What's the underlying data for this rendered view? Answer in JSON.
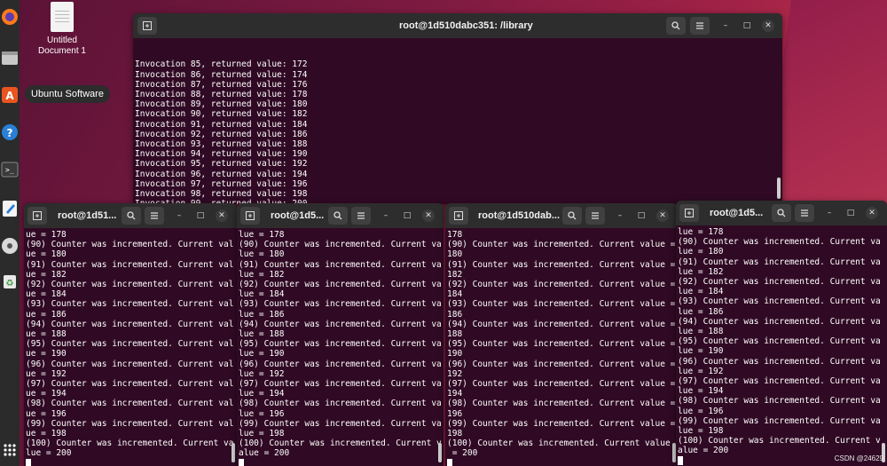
{
  "desktop": {
    "icon_label": "Untitled\nDocument 1",
    "tooltip": "Ubuntu Software",
    "watermark": "CSDN @24629"
  },
  "dock": [
    "firefox-icon",
    "files-icon",
    "software-icon",
    "help-icon",
    "terminal-icon",
    "text-editor-icon",
    "disc-icon",
    "trash-icon",
    "apps-grid-icon"
  ],
  "main_terminal": {
    "title": "root@1d510dabc351: /library",
    "lines": [
      "Invocation 85, returned value: 172",
      "Invocation 86, returned value: 174",
      "Invocation 87, returned value: 176",
      "Invocation 88, returned value: 178",
      "Invocation 89, returned value: 180",
      "Invocation 90, returned value: 182",
      "Invocation 91, returned value: 184",
      "Invocation 92, returned value: 186",
      "Invocation 93, returned value: 188",
      "Invocation 94, returned value: 190",
      "Invocation 95, returned value: 192",
      "Invocation 96, returned value: 194",
      "Invocation 97, returned value: 196",
      "Invocation 98, returned value: 198",
      "Invocation 99, returned value: 200"
    ],
    "prompt": "$ "
  },
  "terminals": [
    {
      "title": "root@1d51...",
      "lines": [
        "ue = 178",
        "(90) Counter was incremented. Current val",
        "ue = 180",
        "(91) Counter was incremented. Current val",
        "ue = 182",
        "(92) Counter was incremented. Current val",
        "ue = 184",
        "(93) Counter was incremented. Current val",
        "ue = 186",
        "(94) Counter was incremented. Current val",
        "ue = 188",
        "(95) Counter was incremented. Current val",
        "ue = 190",
        "(96) Counter was incremented. Current val",
        "ue = 192",
        "(97) Counter was incremented. Current val",
        "ue = 194",
        "(98) Counter was incremented. Current val",
        "ue = 196",
        "(99) Counter was incremented. Current val",
        "ue = 198",
        "(100) Counter was incremented. Current va",
        "lue = 200"
      ]
    },
    {
      "title": "root@1d5...",
      "lines": [
        "lue = 178",
        "(90) Counter was incremented. Current va",
        "lue = 180",
        "(91) Counter was incremented. Current va",
        "lue = 182",
        "(92) Counter was incremented. Current va",
        "lue = 184",
        "(93) Counter was incremented. Current va",
        "lue = 186",
        "(94) Counter was incremented. Current va",
        "lue = 188",
        "(95) Counter was incremented. Current va",
        "lue = 190",
        "(96) Counter was incremented. Current va",
        "lue = 192",
        "(97) Counter was incremented. Current va",
        "lue = 194",
        "(98) Counter was incremented. Current va",
        "lue = 196",
        "(99) Counter was incremented. Current va",
        "lue = 198",
        "(100) Counter was incremented. Current v",
        "alue = 200"
      ]
    },
    {
      "title": "root@1d510dab...",
      "lines": [
        "178",
        "(90) Counter was incremented. Current value =",
        "180",
        "(91) Counter was incremented. Current value =",
        "182",
        "(92) Counter was incremented. Current value =",
        "184",
        "(93) Counter was incremented. Current value =",
        "186",
        "(94) Counter was incremented. Current value =",
        "188",
        "(95) Counter was incremented. Current value =",
        "190",
        "(96) Counter was incremented. Current value =",
        "192",
        "(97) Counter was incremented. Current value =",
        "194",
        "(98) Counter was incremented. Current value =",
        "196",
        "(99) Counter was incremented. Current value =",
        "198",
        "(100) Counter was incremented. Current value",
        " = 200"
      ]
    },
    {
      "title": "root@1d5...",
      "lines": [
        "lue = 178",
        "(90) Counter was incremented. Current va",
        "lue = 180",
        "(91) Counter was incremented. Current va",
        "lue = 182",
        "(92) Counter was incremented. Current va",
        "lue = 184",
        "(93) Counter was incremented. Current va",
        "lue = 186",
        "(94) Counter was incremented. Current va",
        "lue = 188",
        "(95) Counter was incremented. Current va",
        "lue = 190",
        "(96) Counter was incremented. Current va",
        "lue = 192",
        "(97) Counter was incremented. Current va",
        "lue = 194",
        "(98) Counter was incremented. Current va",
        "lue = 196",
        "(99) Counter was incremented. Current va",
        "lue = 198",
        "(100) Counter was incremented. Current v",
        "alue = 200"
      ]
    }
  ]
}
